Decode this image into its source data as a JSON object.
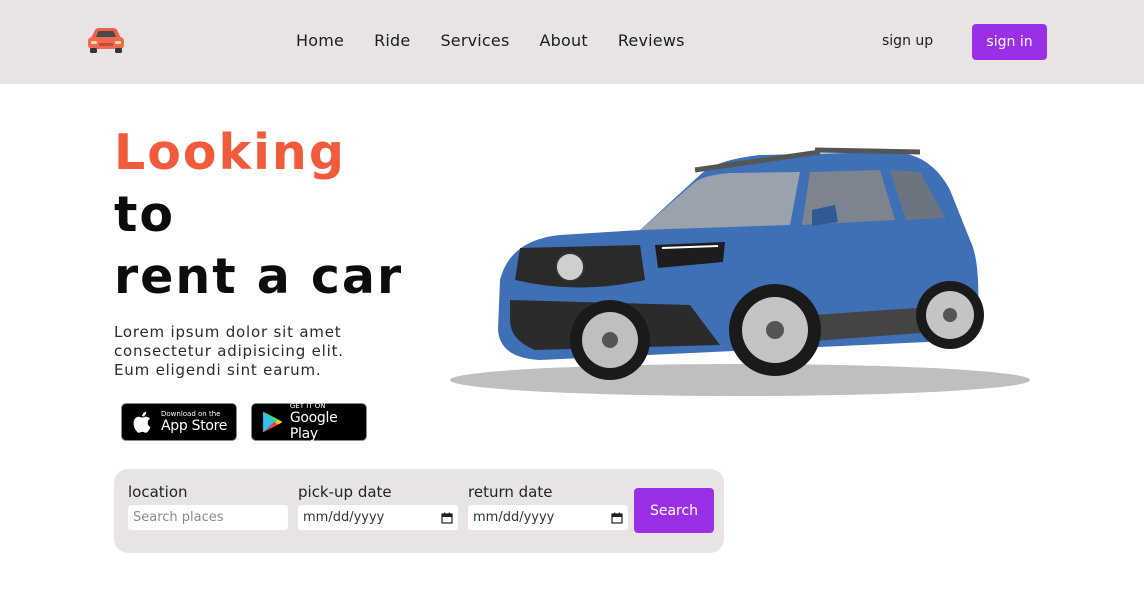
{
  "header": {
    "nav": [
      "Home",
      "Ride",
      "Services",
      "About",
      "Reviews"
    ],
    "signup_label": "sign up",
    "signin_label": "sign in"
  },
  "hero": {
    "title_line1": "Looking",
    "title_line2": "to",
    "title_line3": "rent a car",
    "description": "Lorem ipsum dolor sit amet consectetur adipisicing elit. Eum eligendi sint earum."
  },
  "badges": {
    "apple_small": "Download on the",
    "apple_big": "App Store",
    "google_small": "GET IT ON",
    "google_big": "Google Play"
  },
  "search": {
    "location_label": "location",
    "location_placeholder": "Search places",
    "pickup_label": "pick-up date",
    "pickup_value": "mm/dd/yyyy",
    "return_label": "return date",
    "return_value": "mm/dd/yyyy",
    "button_label": "Search"
  },
  "colors": {
    "accent_orange": "#f25a3c",
    "primary_purple": "#9b2fe8",
    "header_bg": "#e8e4e3"
  },
  "icons": {
    "logo": "car-icon",
    "apple": "apple-icon",
    "google": "google-play-icon",
    "calendar": "calendar-icon"
  }
}
